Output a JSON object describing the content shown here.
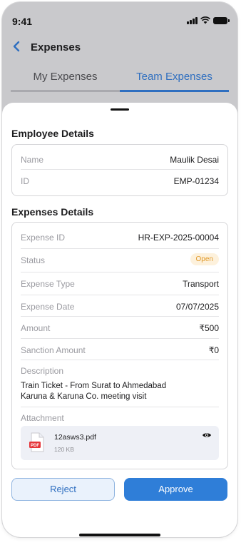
{
  "status_bar": {
    "time": "9:41"
  },
  "header": {
    "title": "Expenses"
  },
  "tabs": [
    {
      "label": "My Expenses",
      "active": false
    },
    {
      "label": "Team Expenses",
      "active": true
    }
  ],
  "employee_details": {
    "title": "Employee Details",
    "rows": [
      {
        "label": "Name",
        "value": "Maulik Desai"
      },
      {
        "label": "ID",
        "value": "EMP-01234"
      }
    ]
  },
  "expenses_details": {
    "title": "Expenses Details",
    "expense_id": {
      "label": "Expense ID",
      "value": "HR-EXP-2025-00004"
    },
    "status": {
      "label": "Status",
      "value": "Open",
      "badge_bg": "#fdf1dc",
      "badge_color": "#e19a2b"
    },
    "expense_type": {
      "label": "Expense Type",
      "value": "Transport"
    },
    "expense_date": {
      "label": "Expense Date",
      "value": "07/07/2025"
    },
    "amount": {
      "label": "Amount",
      "value": "₹500"
    },
    "sanction_amount": {
      "label": "Sanction Amount",
      "value": "₹0"
    },
    "description": {
      "label": "Description",
      "line1": "Train Ticket - From Surat to Ahmedabad",
      "line2": "Karuna & Karuna Co. meeting visit"
    },
    "attachment": {
      "label": "Attachment",
      "file_name": "12asws3.pdf",
      "file_size": "120 KB",
      "file_icon": "pdf-file-icon",
      "file_icon_label": "PDF",
      "view_icon": "eye-icon"
    }
  },
  "actions": {
    "reject_label": "Reject",
    "approve_label": "Approve"
  },
  "colors": {
    "accent": "#2f6fc0",
    "approve_bg": "#2f7ed8",
    "reject_bg": "#eaf2fc",
    "pdf_red": "#e5353a"
  }
}
